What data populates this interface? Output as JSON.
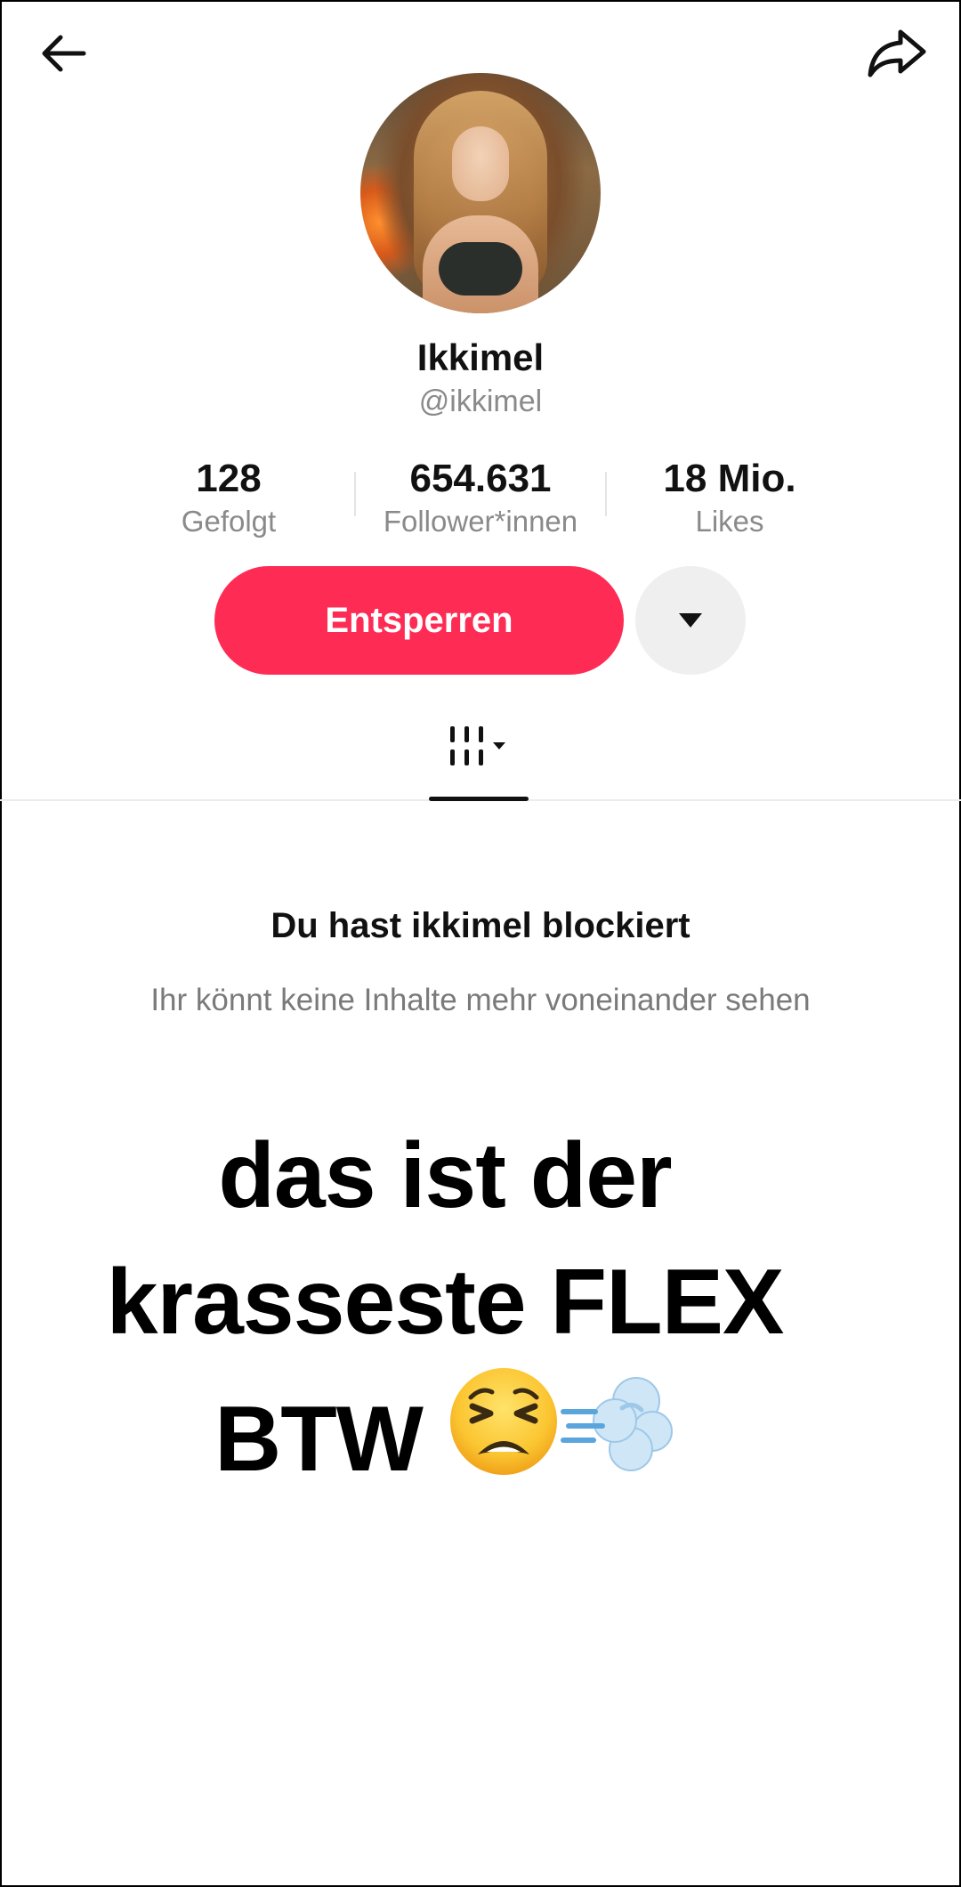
{
  "header": {
    "back_icon": "arrow-left-icon",
    "share_icon": "share-arrow-icon"
  },
  "profile": {
    "display_name": "Ikkimel",
    "handle": "@ikkimel"
  },
  "stats": [
    {
      "value": "128",
      "label": "Gefolgt"
    },
    {
      "value": "654.631",
      "label": "Follower*innen"
    },
    {
      "value": "18 Mio.",
      "label": "Likes"
    }
  ],
  "actions": {
    "unblock_label": "Entsperren",
    "more_icon": "caret-down-icon",
    "accent": "#fe2c55"
  },
  "tabs": {
    "videos_icon": "grid-bars-icon"
  },
  "blocked": {
    "title": "Du hast ikkimel blockiert",
    "subtitle": "Ihr könnt keine Inhalte mehr voneinander sehen"
  },
  "caption": {
    "line1": "das ist der",
    "line2": "krasseste FLEX",
    "line3": "BTW",
    "emojis": [
      "tired-face-emoji",
      "dash-emoji"
    ]
  }
}
